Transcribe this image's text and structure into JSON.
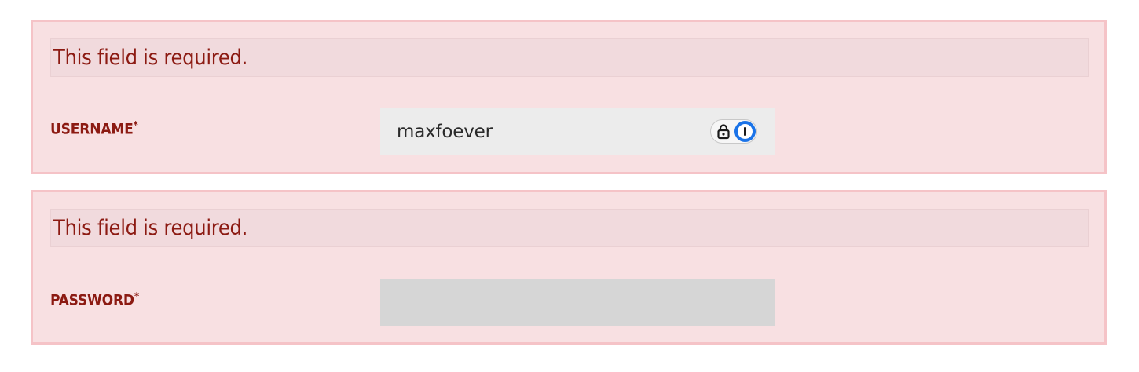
{
  "form": {
    "username": {
      "error": "This field is required.",
      "label": "USERNAME",
      "required_mark": "*",
      "value": "maxfoever"
    },
    "password": {
      "error": "This field is required.",
      "label": "PASSWORD",
      "required_mark": "*",
      "value": ""
    }
  },
  "icons": {
    "password_manager_lock": "lock-icon",
    "password_manager_logo": "onepassword-icon"
  },
  "colors": {
    "error_text": "#8c1a12",
    "error_block_bg": "#f8e0e2",
    "error_block_border": "#f5c3c7",
    "input_bg": "#ececec",
    "password_input_bg": "#d6d6d6",
    "pm_accent": "#1a73e8"
  }
}
